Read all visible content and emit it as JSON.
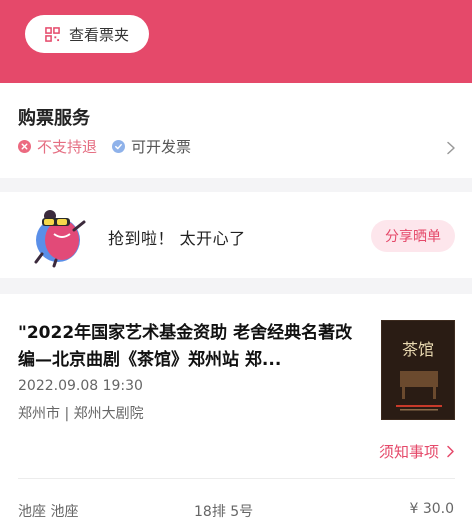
{
  "header": {
    "ticket_button_label": "查看票夹",
    "accent_color": "#e5496a"
  },
  "service": {
    "title": "购票服务",
    "items": [
      {
        "label": "不支持退",
        "icon": "x-circle-icon",
        "color": "#e56e82"
      },
      {
        "label": "可开发票",
        "icon": "check-circle-icon",
        "color": "#8fb2ea"
      }
    ]
  },
  "share": {
    "message": "抢到啦！ 太开心了",
    "button_label": "分享晒单"
  },
  "show": {
    "title": "\"2022年国家艺术基金资助 老舍经典名著改编—北京曲剧《茶馆》郑州站 郑...",
    "datetime": "2022.09.08 19:30",
    "venue": "郑州市 | 郑州大剧院",
    "notice_label": "须知事项",
    "poster_text": "茶馆"
  },
  "seat": {
    "area": "池座 池座",
    "seat": "18排 5号",
    "price": "¥ 30.0"
  }
}
